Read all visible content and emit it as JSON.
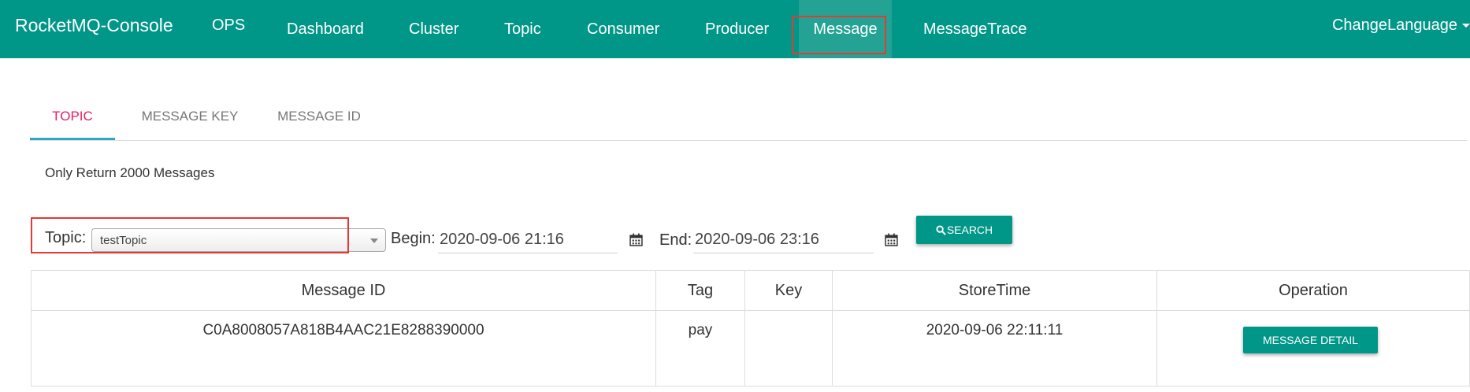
{
  "navbar": {
    "brand": "RocketMQ-Console",
    "items": [
      {
        "label": "OPS"
      },
      {
        "label": "Dashboard"
      },
      {
        "label": "Cluster"
      },
      {
        "label": "Topic"
      },
      {
        "label": "Consumer"
      },
      {
        "label": "Producer"
      },
      {
        "label": "Message",
        "active": true
      },
      {
        "label": "MessageTrace"
      }
    ],
    "language": "ChangeLanguage"
  },
  "tabs": [
    {
      "label": "TOPIC",
      "active": true
    },
    {
      "label": "MESSAGE KEY"
    },
    {
      "label": "MESSAGE ID"
    }
  ],
  "notice": "Only Return 2000 Messages",
  "form": {
    "topic_label": "Topic:",
    "topic_value": "testTopic",
    "begin_label": "Begin:",
    "begin_value": "2020-09-06 21:16",
    "end_label": "End:",
    "end_value": "2020-09-06 23:16",
    "search_label": "SEARCH",
    "search_icon": "search-icon",
    "calendar_icon": "calendar-icon"
  },
  "table": {
    "headers": [
      "Message ID",
      "Tag",
      "Key",
      "StoreTime",
      "Operation"
    ],
    "rows": [
      {
        "message_id": "C0A8008057A818B4AAC21E8288390000",
        "tag": "pay",
        "key": "",
        "store_time": "2020-09-06 22:11:11",
        "operation_label": "MESSAGE DETAIL"
      }
    ]
  },
  "colors": {
    "primary": "#009688",
    "active_tab_text": "#e91e63",
    "tab_indicator": "#2aa8c4",
    "highlight_box": "#e53935"
  }
}
